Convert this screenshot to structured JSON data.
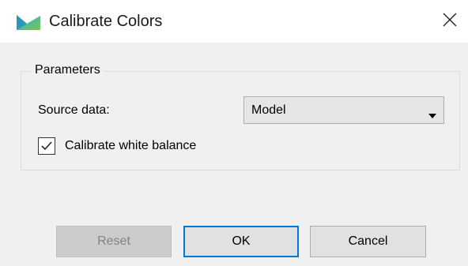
{
  "window": {
    "title": "Calibrate Colors",
    "icons": {
      "app": "app-logo-icon",
      "close": "close-icon"
    }
  },
  "parameters": {
    "group_title": "Parameters",
    "source_label": "Source data:",
    "source_value": "Model",
    "calibrate_white_balance_label": "Calibrate white balance",
    "calibrate_white_balance_checked": true
  },
  "buttons": {
    "reset": "Reset",
    "ok": "OK",
    "cancel": "Cancel"
  },
  "colors": {
    "accent": "#0078d7",
    "icon_teal": "#2ab3c6",
    "icon_green": "#7bc35a"
  }
}
